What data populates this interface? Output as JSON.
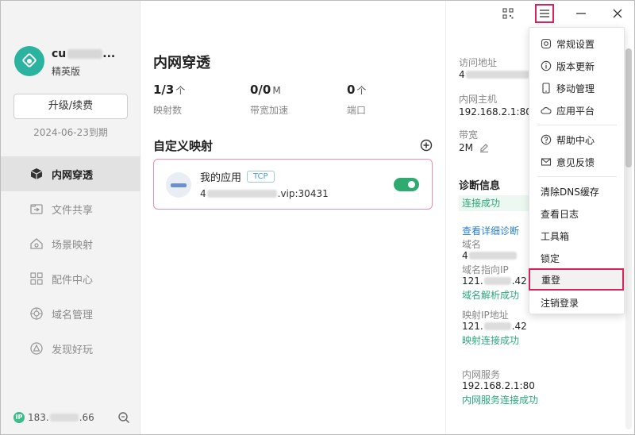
{
  "sidebar": {
    "username_visible": "cu",
    "username_suffix": "...",
    "edition": "精英版",
    "upgrade_label": "升级/续费",
    "expire_text": "2024-06-23到期",
    "items": [
      {
        "label": "内网穿透",
        "icon": "cube-icon",
        "active": true
      },
      {
        "label": "文件共享",
        "icon": "folder-share-icon",
        "active": false
      },
      {
        "label": "场景映射",
        "icon": "home-icon",
        "active": false
      },
      {
        "label": "配件中心",
        "icon": "grid-icon",
        "active": false
      },
      {
        "label": "域名管理",
        "icon": "globe-icon",
        "active": false
      },
      {
        "label": "发现好玩",
        "icon": "triangle-icon",
        "active": false
      }
    ],
    "ip_prefix": "183.",
    "ip_suffix": ".66",
    "ip_badge": "IP"
  },
  "main": {
    "title": "内网穿透",
    "stats": [
      {
        "value": "1/3",
        "unit": "个",
        "label": "映射数"
      },
      {
        "value": "0/0",
        "unit": "M",
        "label": "带宽加速"
      },
      {
        "value": "0",
        "unit": "个",
        "label": "端口"
      }
    ],
    "section_title": "自定义映射",
    "mapping": {
      "name": "我的应用",
      "protocol": "TCP",
      "addr_prefix": "4",
      "addr_suffix": ".vip:30431",
      "enabled": true
    }
  },
  "detail": {
    "access_label": "访问地址",
    "access_prefix": "4",
    "host_label": "内网主机",
    "host_value": "192.168.2.1:80",
    "bandwidth_label": "带宽",
    "bandwidth_value": "2M",
    "diag_title": "诊断信息",
    "diag_status": "连接成功",
    "diag_link": "查看详细诊断",
    "domain_label": "域名",
    "domain_prefix": "4",
    "domain_ip_label": "域名指向IP",
    "domain_ip_prefix": "121.",
    "domain_ip_suffix": ".42",
    "domain_ok": "域名解析成功",
    "map_ip_label": "映射IP地址",
    "map_ip_prefix": "121.",
    "map_ip_suffix": ".42",
    "map_ok": "映射连接成功",
    "service_label": "内网服务",
    "service_value": "192.168.2.1:80",
    "service_ok": "内网服务连接成功"
  },
  "menu": {
    "items": [
      {
        "label": "常规设置",
        "icon": "gear-icon"
      },
      {
        "label": "版本更新",
        "icon": "info-icon"
      },
      {
        "label": "移动管理",
        "icon": "phone-icon"
      },
      {
        "label": "应用平台",
        "icon": "cloud-icon"
      },
      {
        "label": "帮助中心",
        "icon": "help-icon"
      },
      {
        "label": "意见反馈",
        "icon": "mail-icon"
      },
      {
        "label": "清除DNS缓存",
        "icon": ""
      },
      {
        "label": "查看日志",
        "icon": ""
      },
      {
        "label": "工具箱",
        "icon": ""
      },
      {
        "label": "锁定",
        "icon": ""
      },
      {
        "label": "重登",
        "icon": "",
        "selected": true
      },
      {
        "label": "注销登录",
        "icon": ""
      }
    ]
  },
  "colors": {
    "accent_green": "#2faa70",
    "highlight_red": "#d8245a",
    "link_blue": "#2a7fd0"
  }
}
